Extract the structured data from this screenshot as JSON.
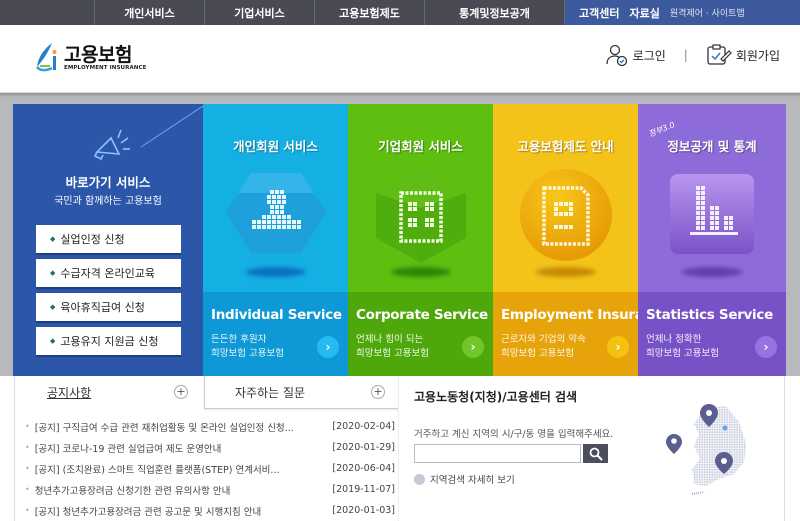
{
  "topnav": {
    "items": [
      "개인서비스",
      "기업서비스",
      "고용보험제도",
      "통계및정보공개"
    ],
    "util_strong": [
      "고객센터",
      "자료실"
    ],
    "util_light": "원격제어 · 사이트맵"
  },
  "header": {
    "logo_ko": "고용보험",
    "logo_en": "EMPLOYMENT INSURANCE",
    "login": "로그인",
    "separator": "|",
    "signup": "회원가입"
  },
  "quick": {
    "title": "바로가기 서비스",
    "subtitle": "국민과 함께하는 고용보험",
    "bullet": "◆",
    "buttons": [
      "실업인정 신청",
      "수급자격 온라인교육",
      "육아휴직급여 신청",
      "고용유지 지원금 신청"
    ]
  },
  "tiles": [
    {
      "title": "개인회원 서비스",
      "en": "Individual Service",
      "desc1": "든든한 후원자",
      "desc2": "희망보험 고용보험",
      "icon": "person-icon",
      "color": "#14b0e3"
    },
    {
      "title": "기업회원 서비스",
      "en": "Corporate Service",
      "desc1": "언제나 힘이 되는",
      "desc2": "희망보험 고용보험",
      "icon": "building-icon",
      "color": "#5fbf10"
    },
    {
      "title": "고용보험제도 안내",
      "en": "Employment Insurance",
      "desc1": "근로자와 기업의 약속",
      "desc2": "희망보험 고용보험",
      "icon": "document-icon",
      "color": "#f4c31a"
    },
    {
      "title": "정보공개 및 통계",
      "badge": "정부3.0",
      "en": "Statistics Service",
      "desc1": "언제나 정확한",
      "desc2": "희망보험 고용보험",
      "icon": "bar-chart-icon",
      "color": "#8d6bd8"
    }
  ],
  "go_arrow": "›",
  "notice": {
    "tab1": "공지사항",
    "tab2": "자주하는 질문",
    "plus": "+",
    "bullet": "•",
    "rows": [
      {
        "title": "[공지] 구직급여 수급 관련 재취업활동 및 온라인 실업인정 신청...",
        "date": "[2020-02-04]"
      },
      {
        "title": "[공지] 코로나-19 관련 실업급여 제도 운영안내",
        "date": "[2020-01-29]"
      },
      {
        "title": "[공지] (조치완료) 스마트 직업훈련 플랫폼(STEP) 연계서비...",
        "date": "[2020-06-04]"
      },
      {
        "title": "청년추가고용장려금 신청기한 관련 유의사항 안내",
        "date": "[2019-11-07]"
      },
      {
        "title": "[공지] 청년추가고용장려금 관련 공고문 및 시행지침 안내",
        "date": "[2020-01-03]"
      }
    ]
  },
  "search": {
    "title": "고용노동청(지청)/고용센터 검색",
    "desc": "거주하고 계신 지역의 시/구/동 명을 입력해주세요.",
    "input_value": "",
    "more": "지역검색 자세히 보기"
  }
}
